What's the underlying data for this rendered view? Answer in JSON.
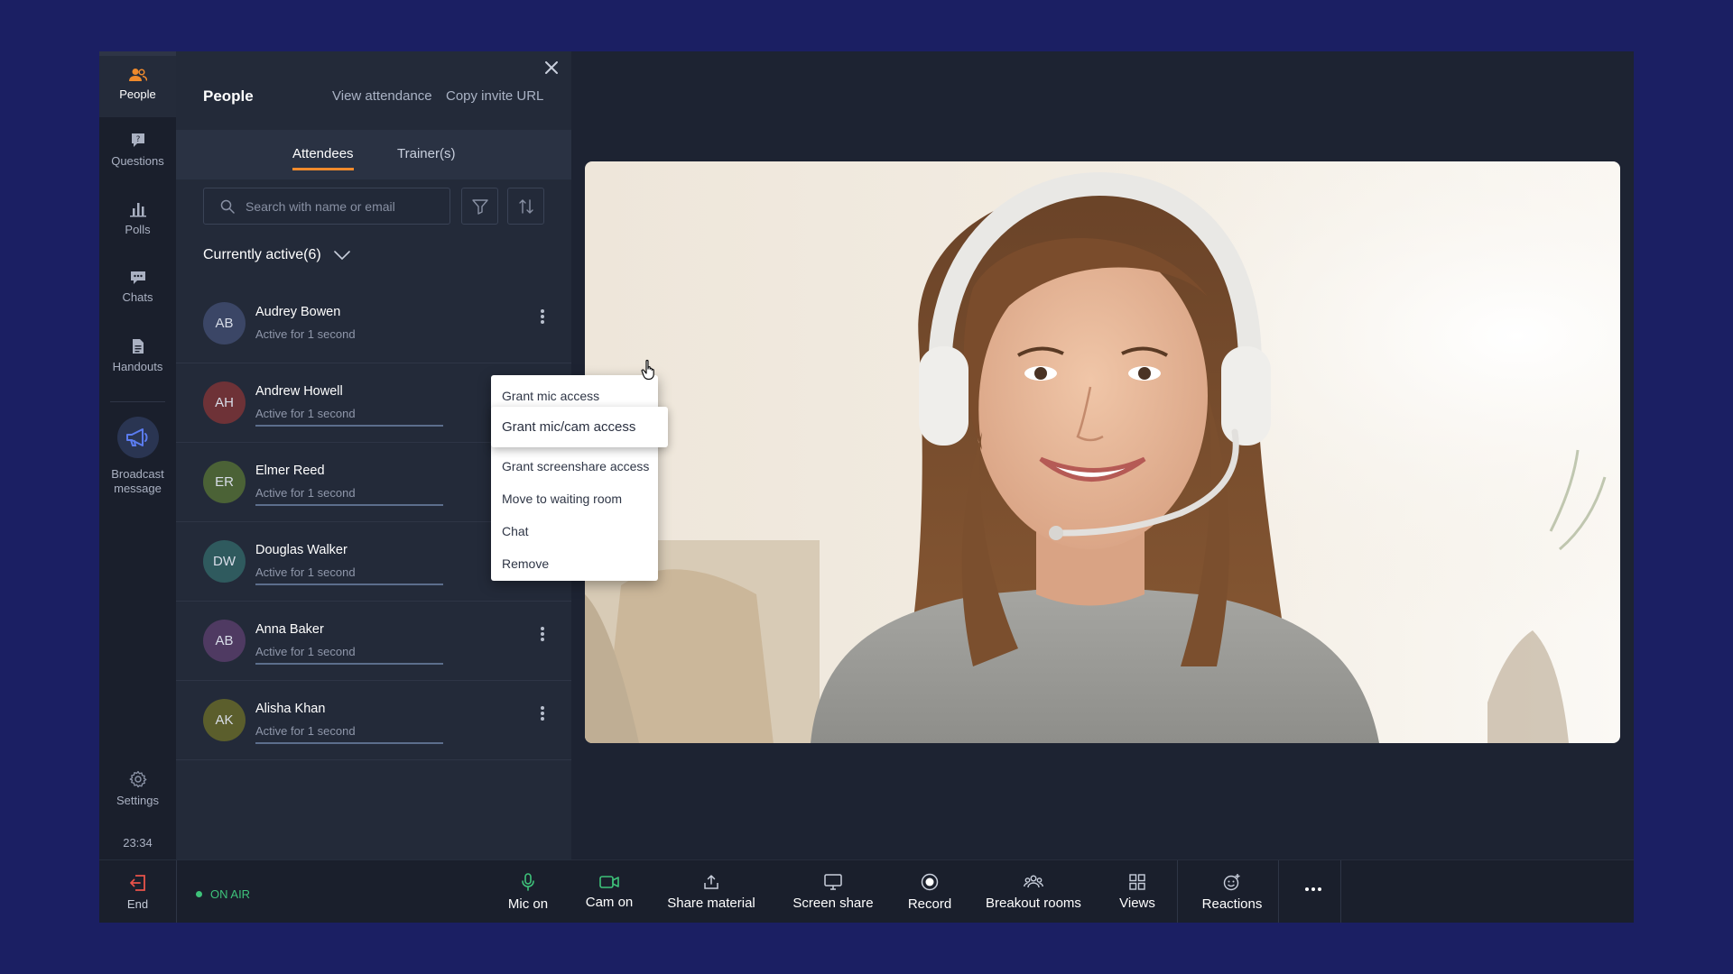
{
  "rail": {
    "items": [
      {
        "label": "People",
        "icon": "people-icon"
      },
      {
        "label": "Questions",
        "icon": "questions-icon"
      },
      {
        "label": "Polls",
        "icon": "polls-icon"
      },
      {
        "label": "Chats",
        "icon": "chats-icon"
      },
      {
        "label": "Handouts",
        "icon": "handouts-icon"
      }
    ],
    "broadcast_line1": "Broadcast",
    "broadcast_line2": "message",
    "settings": "Settings",
    "timer": "23:34"
  },
  "panel": {
    "title": "People",
    "view_attendance": "View attendance",
    "copy_invite": "Copy invite URL",
    "tabs": [
      "Attendees",
      "Trainer(s)"
    ],
    "search_placeholder": "Search with name or email",
    "section_title": "Currently active(6)"
  },
  "attendees": [
    {
      "initials": "AB",
      "name": "Audrey Bowen",
      "status": "Active for 1 second",
      "color": "#3b4666"
    },
    {
      "initials": "AH",
      "name": "Andrew Howell",
      "status": "Active for 1 second",
      "color": "#6e3237"
    },
    {
      "initials": "ER",
      "name": "Elmer Reed",
      "status": "Active for 1 second",
      "color": "#4b6236"
    },
    {
      "initials": "DW",
      "name": "Douglas Walker",
      "status": "Active for 1 second",
      "color": "#2f5a5e"
    },
    {
      "initials": "AB",
      "name": "Anna Baker",
      "status": "Active for 1 second",
      "color": "#4f3a62"
    },
    {
      "initials": "AK",
      "name": "Alisha Khan",
      "status": "Active for 1 second",
      "color": "#5b5e2c"
    }
  ],
  "menu": {
    "items": [
      "Grant mic access",
      "Grant mic/cam access",
      "Grant screenshare access",
      "Move to waiting room",
      "Chat",
      "Remove"
    ]
  },
  "bottom": {
    "end": "End",
    "on_air": "ON AIR",
    "tools": [
      "Mic on",
      "Cam on",
      "Share material",
      "Screen share",
      "Record",
      "Breakout rooms",
      "Views",
      "Reactions"
    ]
  },
  "colors": {
    "accent": "#f08a2c",
    "on_air": "#3ec27a",
    "end": "#e8534a"
  }
}
